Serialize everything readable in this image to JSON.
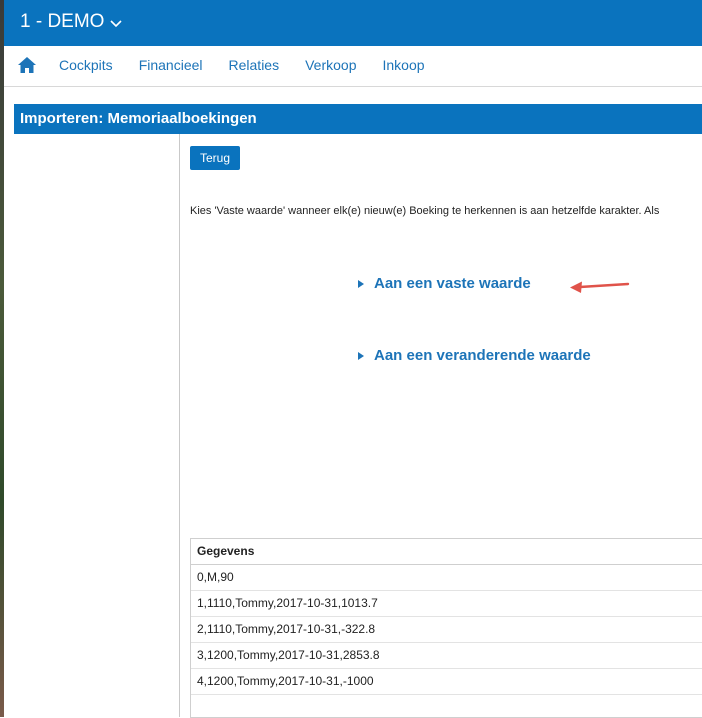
{
  "header": {
    "company": "1 - DEMO",
    "company_chevron": "chevron-down-icon"
  },
  "nav": {
    "home_icon": "home-icon",
    "items": [
      "Cockpits",
      "Financieel",
      "Relaties",
      "Verkoop",
      "Inkoop"
    ]
  },
  "page": {
    "title": "Importeren: Memoriaalboekingen",
    "back_button": "Terug",
    "instruction": "Kies 'Vaste waarde' wanneer elk(e) nieuw(e) Boeking te herkennen is aan hetzelfde karakter. Als",
    "options": [
      {
        "label": "Aan een vaste waarde",
        "icon": "triangle-right-icon"
      },
      {
        "label": "Aan een veranderende waarde",
        "icon": "triangle-right-icon"
      }
    ],
    "annotation": "red-arrow-icon"
  },
  "table": {
    "header": "Gegevens",
    "rows": [
      "0,M,90",
      "1,1110,Tommy,2017-10-31,1013.7",
      "2,1110,Tommy,2017-10-31,-322.8",
      "3,1200,Tommy,2017-10-31,2853.8",
      "4,1200,Tommy,2017-10-31,-1000"
    ]
  },
  "colors": {
    "brand_blue": "#0a73be",
    "link_blue": "#1d74b8",
    "annotation_red": "#e0534a"
  }
}
